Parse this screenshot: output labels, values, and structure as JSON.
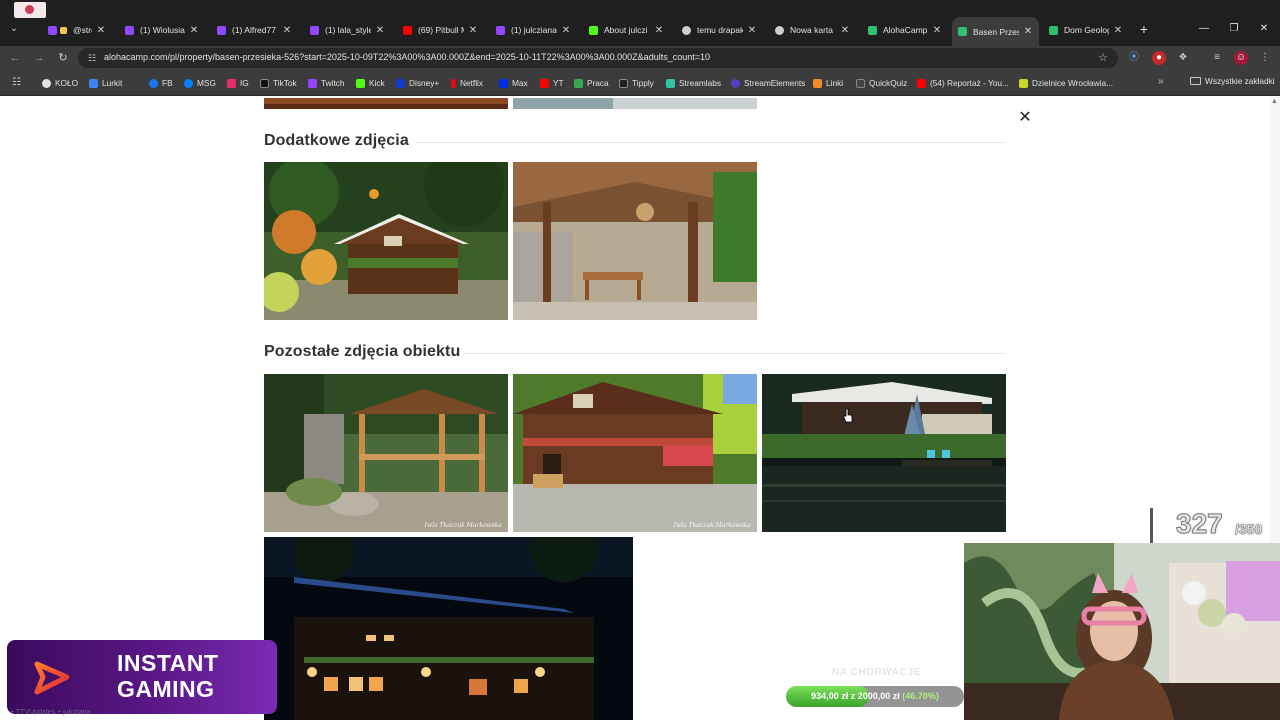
{
  "browser": {
    "tabs": [
      {
        "label": "@stream",
        "color": "#f2c94c",
        "active": false
      },
      {
        "label": "(1) Wiolusia",
        "color": "#9146ff",
        "active": false
      },
      {
        "label": "(1) Alfred77",
        "color": "#9146ff",
        "active": false
      },
      {
        "label": "(1) lala_style",
        "color": "#9146ff",
        "active": false
      },
      {
        "label": "(69) Pitbull M",
        "color": "#ff0000",
        "active": false
      },
      {
        "label": "(1) julcziana",
        "color": "#9146ff",
        "active": false
      },
      {
        "label": "About julczi",
        "color": "#53fc18",
        "active": false
      },
      {
        "label": "temu drapak",
        "color": "#cfcfcf",
        "active": false
      },
      {
        "label": "Nowa karta",
        "color": "#cfcfcf",
        "active": false
      },
      {
        "label": "AlohaCamp",
        "color": "#2fbf71",
        "active": false
      },
      {
        "label": "Basen Przesi",
        "color": "#2fbf71",
        "active": true
      },
      {
        "label": "Dom Geologa",
        "color": "#2fbf71",
        "active": false
      }
    ],
    "url": "alohacamp.com/pl/property/basen-przesieka-526?start=2025-10-09T22%3A00%3A00.000Z&end=2025-10-11T22%3A00%3A00.000Z&adults_count=10",
    "bookmarks": [
      {
        "label": "KOŁO",
        "color": "#e4e4e4"
      },
      {
        "label": "Lurkit",
        "color": "#3b82f6"
      },
      {
        "label": "FB",
        "color": "#1877f2"
      },
      {
        "label": "MSG",
        "color": "#0084ff"
      },
      {
        "label": "IG",
        "color": "#e1306c"
      },
      {
        "label": "TikTok",
        "color": "#111111"
      },
      {
        "label": "Twitch",
        "color": "#9146ff"
      },
      {
        "label": "Kick",
        "color": "#53fc18"
      },
      {
        "label": "Disney+",
        "color": "#113ccf"
      },
      {
        "label": "Netflix",
        "color": "#e50914"
      },
      {
        "label": "Max",
        "color": "#002be7"
      },
      {
        "label": "YT",
        "color": "#ff0000"
      },
      {
        "label": "Praca",
        "color": "#34a853"
      },
      {
        "label": "Tipply",
        "color": "#222222"
      },
      {
        "label": "Streamlabs",
        "color": "#31c3a2"
      },
      {
        "label": "StreamElements",
        "color": "#5b3cc4"
      },
      {
        "label": "Linki",
        "color": "#f28c28"
      },
      {
        "label": "QuickQuiz",
        "color": "#444444"
      },
      {
        "label": "(54) Reportaż - You...",
        "color": "#ff0000"
      },
      {
        "label": "Dzielnice Wrocławia...",
        "color": "#c6d92a"
      }
    ],
    "all_bookmarks": "Wszystkie zakładki"
  },
  "page": {
    "section_additional": "Dodatkowe zdjęcia",
    "section_other": "Pozostałe zdjęcia obiektu",
    "watermark": "Iwla Tkaczuk Markowska"
  },
  "overlay": {
    "sponsor_line1": "INSTANT",
    "sponsor_line2": "GAMING",
    "counter_value": "327",
    "counter_max": "/350",
    "goal_title": "NA CHORWACJĘ",
    "goal_current": "934,00 zł",
    "goal_target": "2000,00 zł",
    "goal_percent": "(46.70%)",
    "goal_progress": 0.467,
    "footer_text": "+ TTVUpdates + julcziana"
  }
}
